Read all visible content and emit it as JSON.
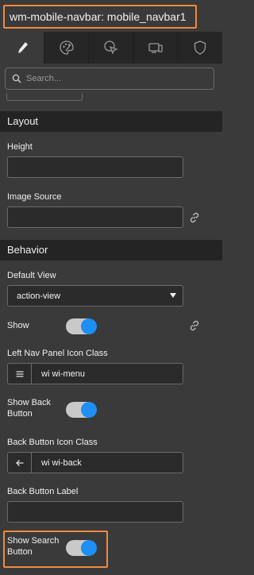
{
  "header": {
    "title": "wm-mobile-navbar: mobile_navbar1"
  },
  "tabs": [
    {
      "name": "properties",
      "icon": "pencil-icon",
      "active": true
    },
    {
      "name": "styles",
      "icon": "palette-icon",
      "active": false
    },
    {
      "name": "events",
      "icon": "cursor-click-icon",
      "active": false
    },
    {
      "name": "device",
      "icon": "devices-icon",
      "active": false
    },
    {
      "name": "security",
      "icon": "shield-icon",
      "active": false
    }
  ],
  "search": {
    "placeholder": "Search..."
  },
  "sections": {
    "layout": {
      "title": "Layout",
      "height": {
        "label": "Height",
        "value": ""
      },
      "image_source": {
        "label": "Image Source",
        "value": ""
      }
    },
    "behavior": {
      "title": "Behavior",
      "default_view": {
        "label": "Default View",
        "value": "action-view"
      },
      "show": {
        "label": "Show",
        "on": true
      },
      "left_nav_icon": {
        "label": "Left Nav Panel Icon Class",
        "value": "wi wi-menu"
      },
      "show_back_button": {
        "label": "Show Back Button",
        "on": true
      },
      "back_button_icon": {
        "label": "Back Button Icon Class",
        "value": "wi wi-back"
      },
      "back_button_label": {
        "label": "Back Button Label",
        "value": ""
      },
      "show_search_button": {
        "label": "Show Search Button",
        "on": true
      }
    }
  },
  "colors": {
    "highlight": "#f08a3e",
    "toggle_on": "#1e8ff5",
    "panel_bg": "#3a3a3a",
    "section_bg": "#242424"
  }
}
